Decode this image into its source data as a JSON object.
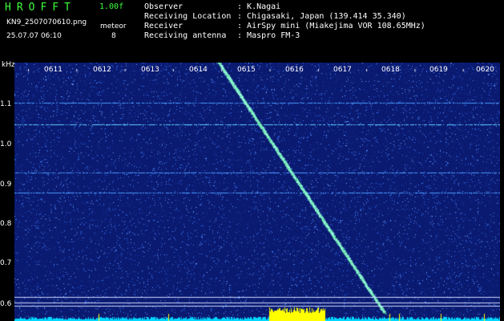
{
  "header": {
    "logo": "HROFFT",
    "version": "1.00f",
    "filename": "KN9_2507070610.png",
    "datetime": "25.07.07 06:10",
    "meteor_label": "meteor",
    "meteor_count": "8"
  },
  "info": [
    {
      "label": "Observer",
      "value": "K.Nagai"
    },
    {
      "label": "Receiving Location",
      "value": "Chigasaki, Japan (139.414 35.340)"
    },
    {
      "label": "Receiver",
      "value": "AirSpy mini (Miakejima VOR 108.65MHz)"
    },
    {
      "label": "Receiving antenna",
      "value": "Maspro FM-3"
    }
  ],
  "chart_data": {
    "type": "heatmap",
    "ylabel": "kHz",
    "y_ticks": [
      "1.1",
      "1.0",
      "0.9",
      "0.8",
      "0.7",
      "0.6"
    ],
    "x_ticks": [
      "0611",
      "0612",
      "0613",
      "0614",
      "0615",
      "0616",
      "0617",
      "0618",
      "0619",
      "0620"
    ],
    "colors": {
      "background": "#0a1a70",
      "noise": "#3a7cff",
      "trace": "#9affe0",
      "level": "#00d8ff",
      "burst": "#ffff00"
    }
  }
}
